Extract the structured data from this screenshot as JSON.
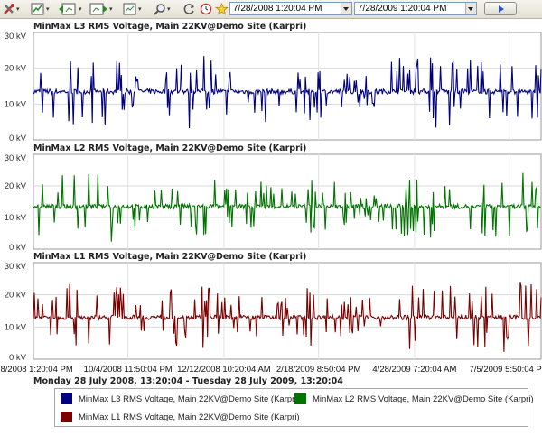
{
  "toolbar": {
    "icons": [
      "tools-icon",
      "bar-add-icon",
      "bar-back-icon",
      "bar-forward-icon",
      "bar-zoom-icon",
      "magnifier-icon",
      "refresh-icon",
      "history-icon",
      "star-icon"
    ],
    "start_date": "7/28/2008 1:20:04 PM",
    "end_date": "7/28/2009 1:20:04 PM",
    "go_icon": "play-icon"
  },
  "chart_data": [
    {
      "type": "line",
      "title": "MinMax L3 RMS Voltage, Main 22KV@Demo Site (Karpri)",
      "yticks": [
        "0 kV",
        "10 kV",
        "20 kV",
        "30 kV"
      ],
      "ylim": [
        0,
        30
      ],
      "color": "#000080",
      "series": [
        {
          "name": "MinMax L3 RMS Voltage, Main 22KV@Demo Site (Karpri)",
          "baseline_kv": 13.5,
          "x": [
            "7/28/2008",
            "8/10/2008",
            "8/25/2008",
            "9/8/2008",
            "9/23/2008",
            "10/8/2008",
            "10/24/2008",
            "11/9/2008",
            "11/25/2008",
            "12/10/2008",
            "12/26/2008",
            "1/11/2009",
            "1/27/2009",
            "2/12/2009",
            "2/28/2009",
            "3/15/2009",
            "3/31/2009",
            "4/16/2009",
            "5/2/2009",
            "5/18/2009",
            "6/3/2009",
            "6/19/2009",
            "7/5/2009",
            "7/28/2009"
          ],
          "max": [
            19,
            21,
            22,
            22,
            24,
            20,
            18,
            22,
            26,
            21,
            20,
            22,
            18,
            21,
            20,
            18,
            18,
            25,
            23,
            24,
            22,
            24,
            24,
            22
          ],
          "min": [
            5,
            6,
            4,
            3,
            1,
            6,
            7,
            4,
            2,
            6,
            8,
            4,
            8,
            5,
            6,
            9,
            9,
            3,
            4,
            2,
            6,
            5,
            3,
            4
          ]
        }
      ]
    },
    {
      "type": "line",
      "title": "MinMax L2 RMS Voltage, Main 22KV@Demo Site (Karpri)",
      "yticks": [
        "0 kV",
        "10 kV",
        "20 kV",
        "30 kV"
      ],
      "ylim": [
        0,
        30
      ],
      "color": "#007300",
      "series": [
        {
          "name": "MinMax L2 RMS Voltage, Main 22KV@Demo Site (Karpri)",
          "baseline_kv": 13.5,
          "x": [
            "7/28/2008",
            "8/10/2008",
            "8/25/2008",
            "9/8/2008",
            "9/23/2008",
            "10/8/2008",
            "10/24/2008",
            "11/9/2008",
            "11/25/2008",
            "12/10/2008",
            "12/26/2008",
            "1/11/2009",
            "1/27/2009",
            "2/12/2009",
            "2/28/2009",
            "3/15/2009",
            "3/31/2009",
            "4/16/2009",
            "5/2/2009",
            "5/18/2009",
            "6/3/2009",
            "6/19/2009",
            "7/5/2009",
            "7/28/2009"
          ],
          "max": [
            20,
            22,
            25,
            24,
            23,
            21,
            19,
            22,
            24,
            21,
            20,
            22,
            19,
            22,
            22,
            19,
            19,
            24,
            23,
            23,
            22,
            23,
            25,
            23
          ],
          "min": [
            4,
            5,
            2,
            3,
            1,
            6,
            7,
            4,
            3,
            6,
            8,
            4,
            7,
            4,
            5,
            8,
            9,
            3,
            4,
            3,
            5,
            4,
            2,
            4
          ]
        }
      ]
    },
    {
      "type": "line",
      "title": "MinMax L1 RMS Voltage, Main 22KV@Demo Site (Karpri)",
      "yticks": [
        "0 kV",
        "10 kV",
        "20 kV",
        "30 kV"
      ],
      "ylim": [
        0,
        30
      ],
      "color": "#7a0000",
      "series": [
        {
          "name": "MinMax L1 RMS Voltage, Main 22KV@Demo Site (Karpri)",
          "baseline_kv": 13.0,
          "x": [
            "7/28/2008",
            "8/10/2008",
            "8/25/2008",
            "9/8/2008",
            "9/23/2008",
            "10/8/2008",
            "10/24/2008",
            "11/9/2008",
            "11/25/2008",
            "12/10/2008",
            "12/26/2008",
            "1/11/2009",
            "1/27/2009",
            "2/12/2009",
            "2/28/2009",
            "3/15/2009",
            "3/31/2009",
            "4/16/2009",
            "5/2/2009",
            "5/18/2009",
            "6/3/2009",
            "6/19/2009",
            "7/5/2009",
            "7/28/2009"
          ],
          "max": [
            21,
            22,
            24,
            23,
            24,
            21,
            19,
            23,
            24,
            21,
            20,
            23,
            19,
            23,
            22,
            19,
            20,
            25,
            23,
            23,
            23,
            24,
            27,
            23
          ],
          "min": [
            4,
            5,
            2,
            2,
            1,
            6,
            7,
            4,
            3,
            6,
            8,
            3,
            8,
            4,
            5,
            8,
            9,
            2,
            4,
            3,
            5,
            3,
            1,
            3
          ]
        }
      ]
    }
  ],
  "x_axis": {
    "ticks": [
      "7/28/2008 1:20:04 PM",
      "10/4/2008 11:50:04 PM",
      "12/12/2008 10:20:04 AM",
      "2/18/2009 8:50:04 PM",
      "4/28/2009 7:20:04 AM",
      "7/5/2009 5:50:04 PM"
    ],
    "range_label": "Monday 28 July 2008, 13:20:04 - Tuesday 28 July 2009, 13:20:04"
  },
  "legend": [
    {
      "label": "MinMax L3 RMS Voltage, Main 22KV@Demo Site (Karpri)",
      "color": "#000080"
    },
    {
      "label": "MinMax L2 RMS Voltage, Main 22KV@Demo Site (Karpri)",
      "color": "#007300"
    },
    {
      "label": "MinMax L1 RMS Voltage, Main 22KV@Demo Site (Karpri)",
      "color": "#7a0000"
    }
  ]
}
